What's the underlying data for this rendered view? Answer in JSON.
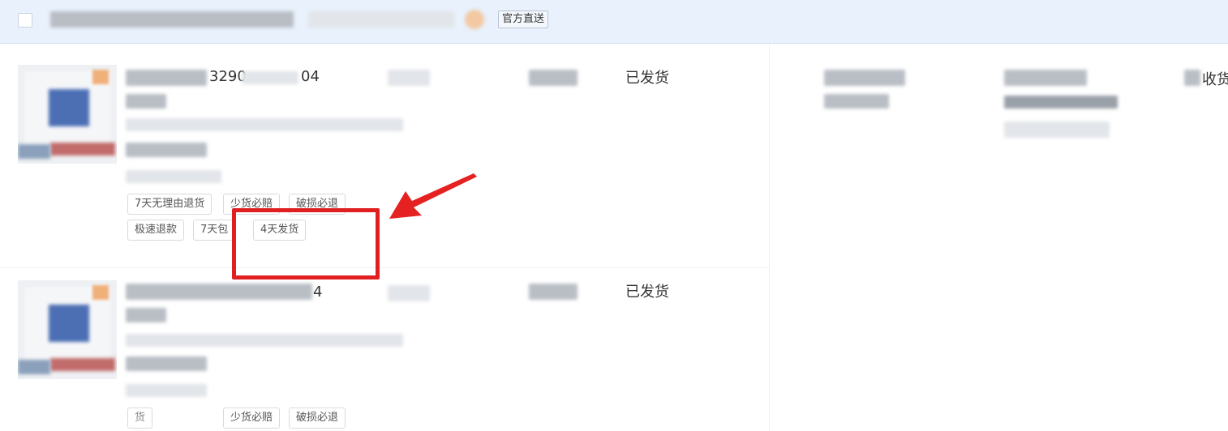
{
  "header": {
    "official_direct_label": "官方直送"
  },
  "orders": [
    {
      "id_fragment_a": "3290",
      "id_fragment_b": "04",
      "status": "已发货",
      "service_tags_row1": [
        "7天无理由退货",
        "少货必赔",
        "破损必退"
      ],
      "service_tags_row2": [
        "极速退款",
        "7天包",
        "4天发货"
      ]
    },
    {
      "id_fragment_b": "4",
      "status": "已发货",
      "service_tags_row1": [
        "货",
        "少货必赔",
        "破损必退"
      ]
    }
  ],
  "right_panel": {
    "partial_text": "收货"
  },
  "annotation": {
    "highlight_color": "#e02020",
    "arrow_color": "#e52121"
  }
}
